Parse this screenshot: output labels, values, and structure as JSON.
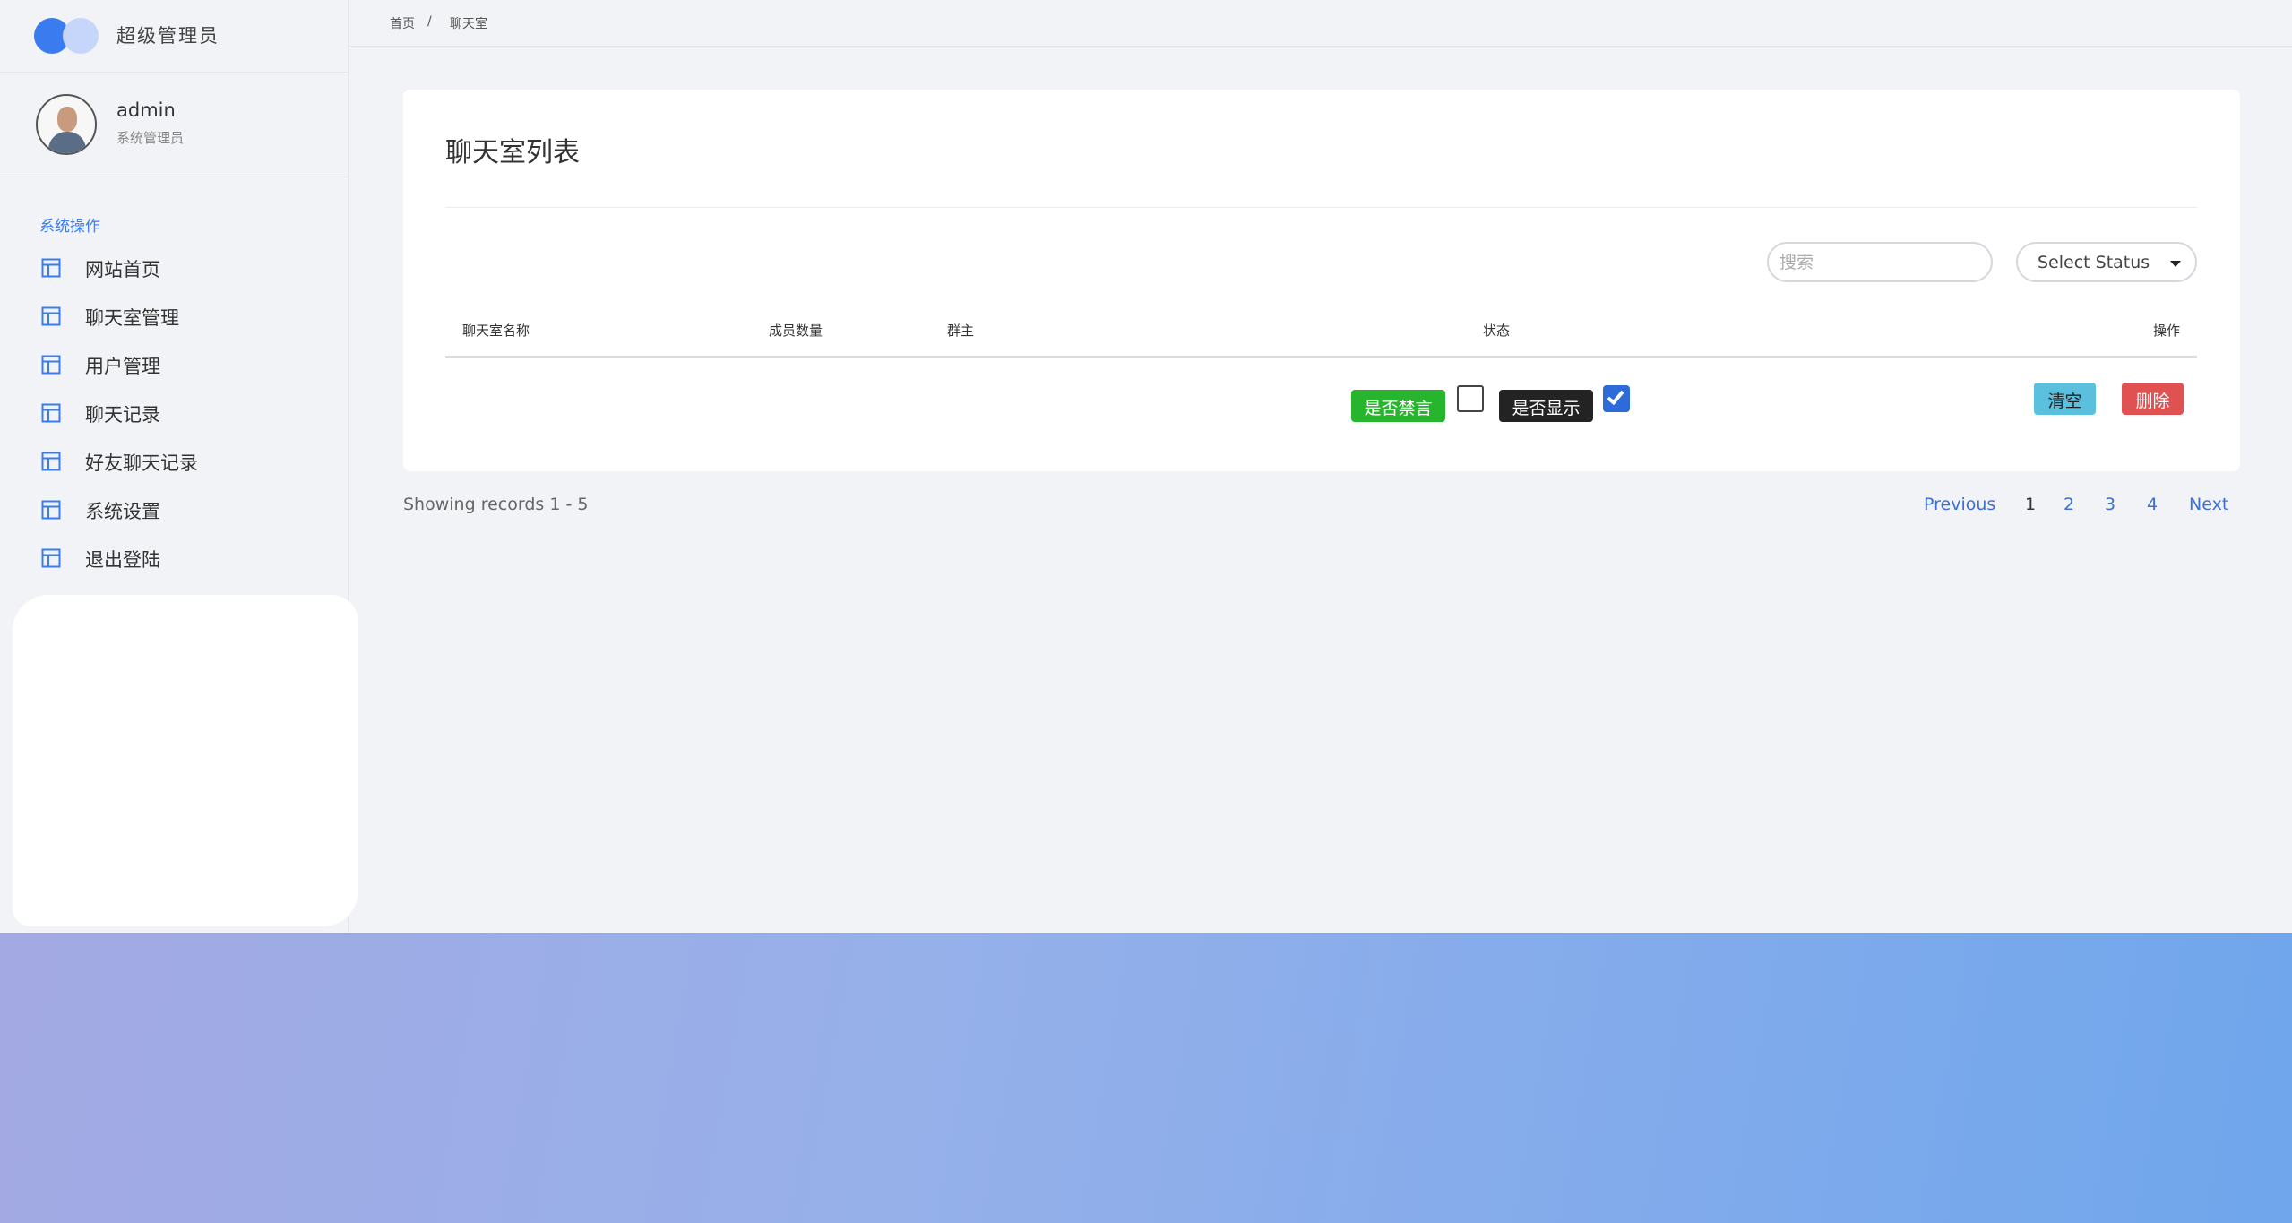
{
  "brand": {
    "title": "超级管理员"
  },
  "user": {
    "name": "admin",
    "role": "系统管理员"
  },
  "sidebar": {
    "section_label": "系统操作",
    "items": [
      {
        "label": "网站首页",
        "icon": "layout-icon"
      },
      {
        "label": "聊天室管理",
        "icon": "layout-icon"
      },
      {
        "label": "用户管理",
        "icon": "layout-icon"
      },
      {
        "label": "聊天记录",
        "icon": "layout-icon"
      },
      {
        "label": "好友聊天记录",
        "icon": "layout-icon"
      },
      {
        "label": "系统设置",
        "icon": "layout-icon"
      },
      {
        "label": "退出登陆",
        "icon": "layout-icon"
      }
    ]
  },
  "breadcrumb": {
    "home": "首页",
    "separator": "/",
    "current": "聊天室"
  },
  "main": {
    "title": "聊天室列表",
    "search_placeholder": "搜索",
    "status_select": "Select Status",
    "columns": [
      "聊天室名称",
      "成员数量",
      "群主",
      "状态",
      "操作"
    ],
    "row": {
      "ban_label": "是否禁言",
      "ban_checked": false,
      "show_label": "是否显示",
      "show_checked": true,
      "clear_label": "清空",
      "delete_label": "删除"
    }
  },
  "pagination": {
    "records": "Showing records 1 - 5",
    "previous": "Previous",
    "pages": [
      "1",
      "2",
      "3",
      "4"
    ],
    "next": "Next",
    "current": "1"
  },
  "colors": {
    "accent": "#3a7cf0",
    "success": "#28b52e",
    "danger": "#e05252",
    "info": "#5bc0de"
  }
}
